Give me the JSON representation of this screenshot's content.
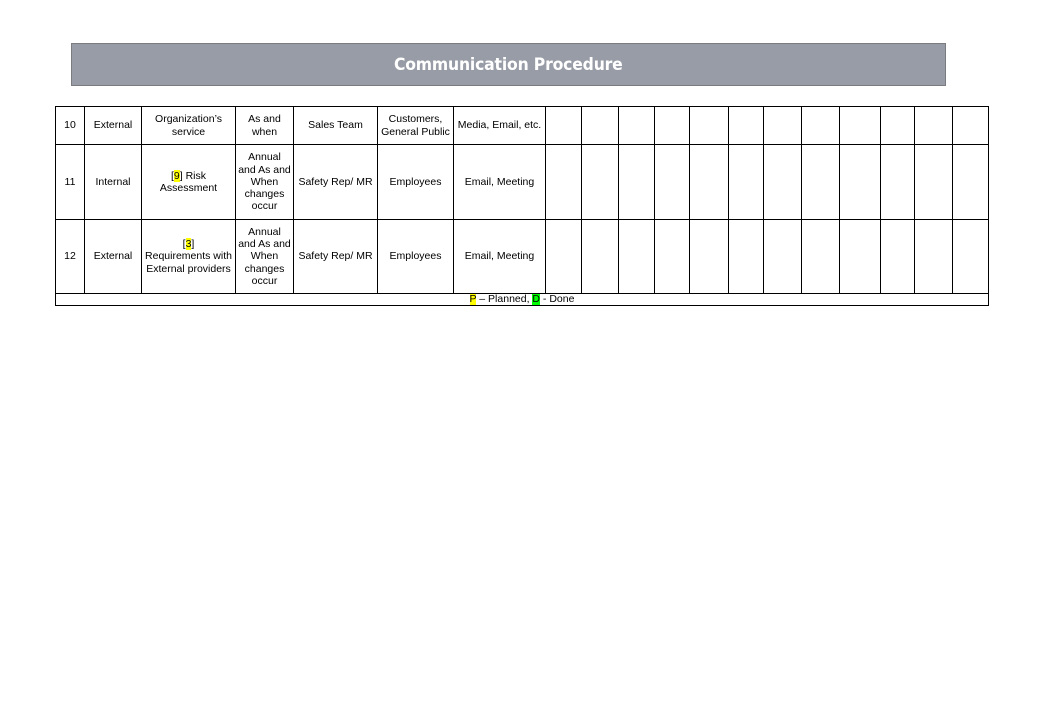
{
  "header": {
    "title": "Communication Procedure"
  },
  "table": {
    "rows": [
      {
        "no": "10",
        "type": "External",
        "subject_ref": "",
        "subject": "Organization’s service",
        "frequency": "As and when",
        "responsible": "Sales Team",
        "audience": "Customers, General Public",
        "method": "Media, Email, etc."
      },
      {
        "no": "11",
        "type": "Internal",
        "subject_ref": "9",
        "subject": "Risk Assessment",
        "frequency": "Annual and As and When changes occur",
        "responsible": "Safety Rep/ MR",
        "audience": "Employees",
        "method": "Email, Meeting"
      },
      {
        "no": "12",
        "type": "External",
        "subject_ref": "3",
        "subject": "Requirements with External providers",
        "frequency": "Annual and As and When changes occur",
        "responsible": "Safety Rep/ MR",
        "audience": "Employees",
        "method": "Email, Meeting"
      }
    ],
    "schedule_columns_count": 12,
    "legend": {
      "planned_code": "P",
      "planned_label": " – Planned, ",
      "done_code": "D",
      "done_label": " - Done"
    }
  },
  "colors": {
    "title_bar": "#989ca6",
    "planned_highlight": "#ffff00",
    "done_highlight": "#00ff00"
  }
}
